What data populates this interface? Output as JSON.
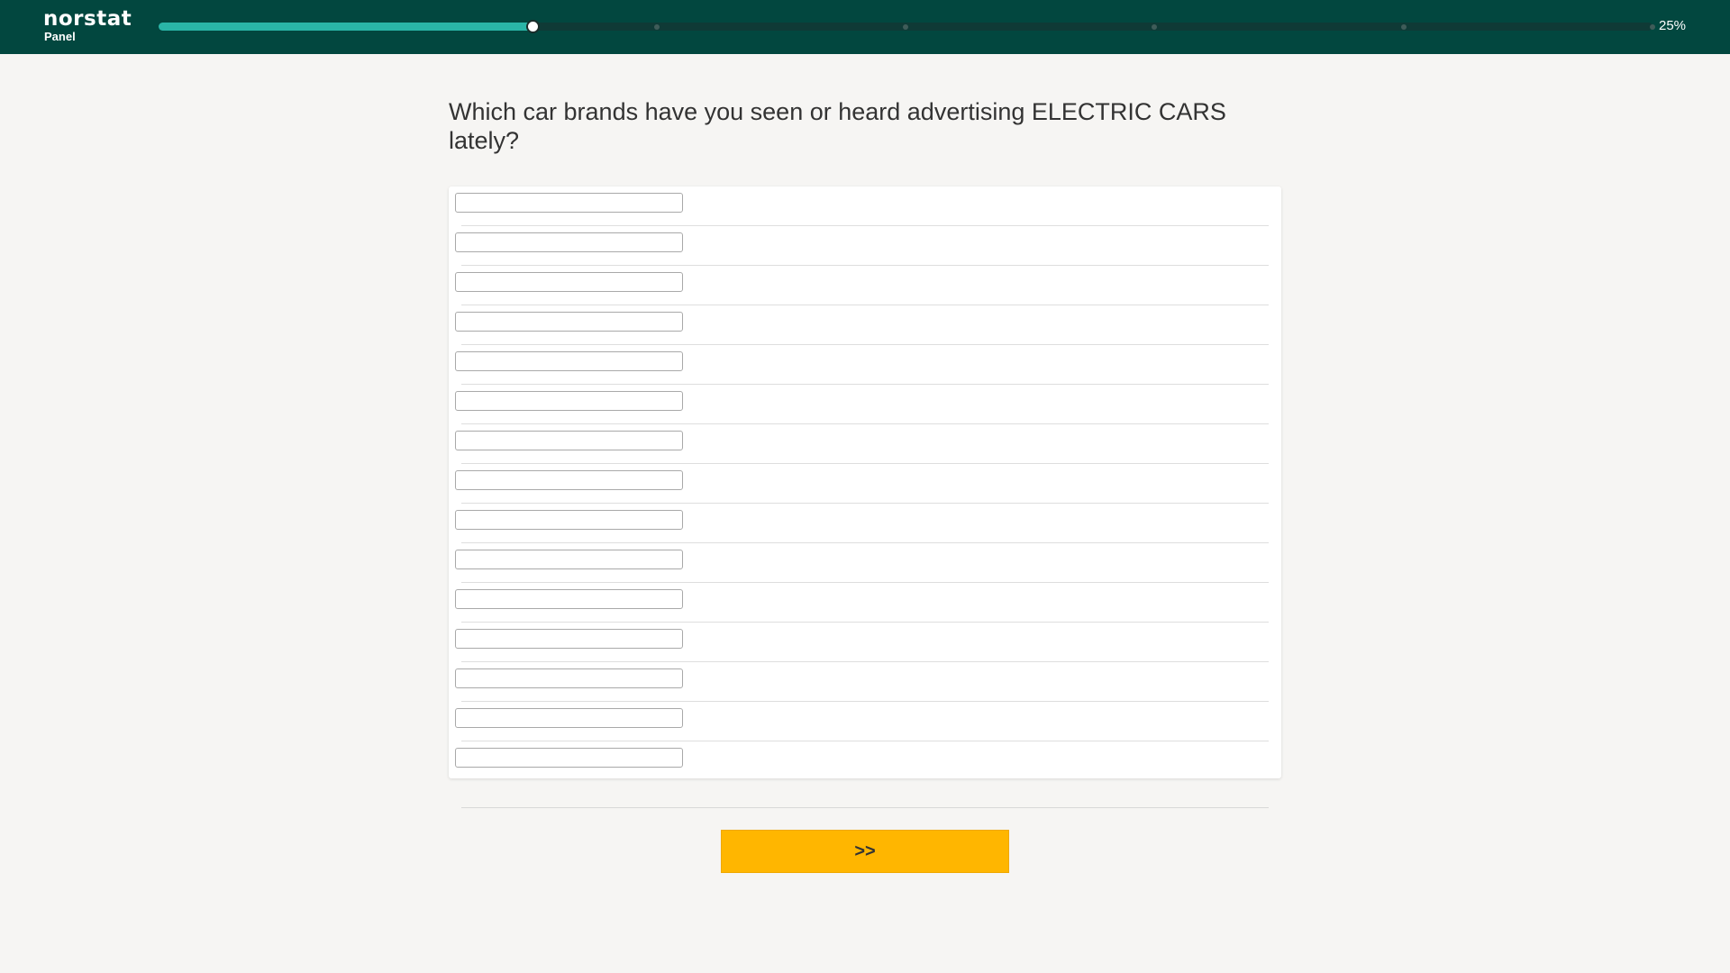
{
  "header": {
    "logo_text": "norstat",
    "logo_subtext": "Panel",
    "progress": {
      "percent": 25,
      "label": "25%",
      "milestone_count": 7
    }
  },
  "question": {
    "text": "Which car brands have you seen or heard advertising ELECTRIC CARS lately?"
  },
  "answers": {
    "fields": [
      {
        "value": ""
      },
      {
        "value": ""
      },
      {
        "value": ""
      },
      {
        "value": ""
      },
      {
        "value": ""
      },
      {
        "value": ""
      },
      {
        "value": ""
      },
      {
        "value": ""
      },
      {
        "value": ""
      },
      {
        "value": ""
      },
      {
        "value": ""
      },
      {
        "value": ""
      },
      {
        "value": ""
      },
      {
        "value": ""
      },
      {
        "value": ""
      }
    ]
  },
  "navigation": {
    "next_label": ">>"
  },
  "colors": {
    "header_bg": "#02473f",
    "progress_fill": "#2ab5a7",
    "page_bg": "#f6f5f3",
    "next_button": "#ffb600"
  }
}
